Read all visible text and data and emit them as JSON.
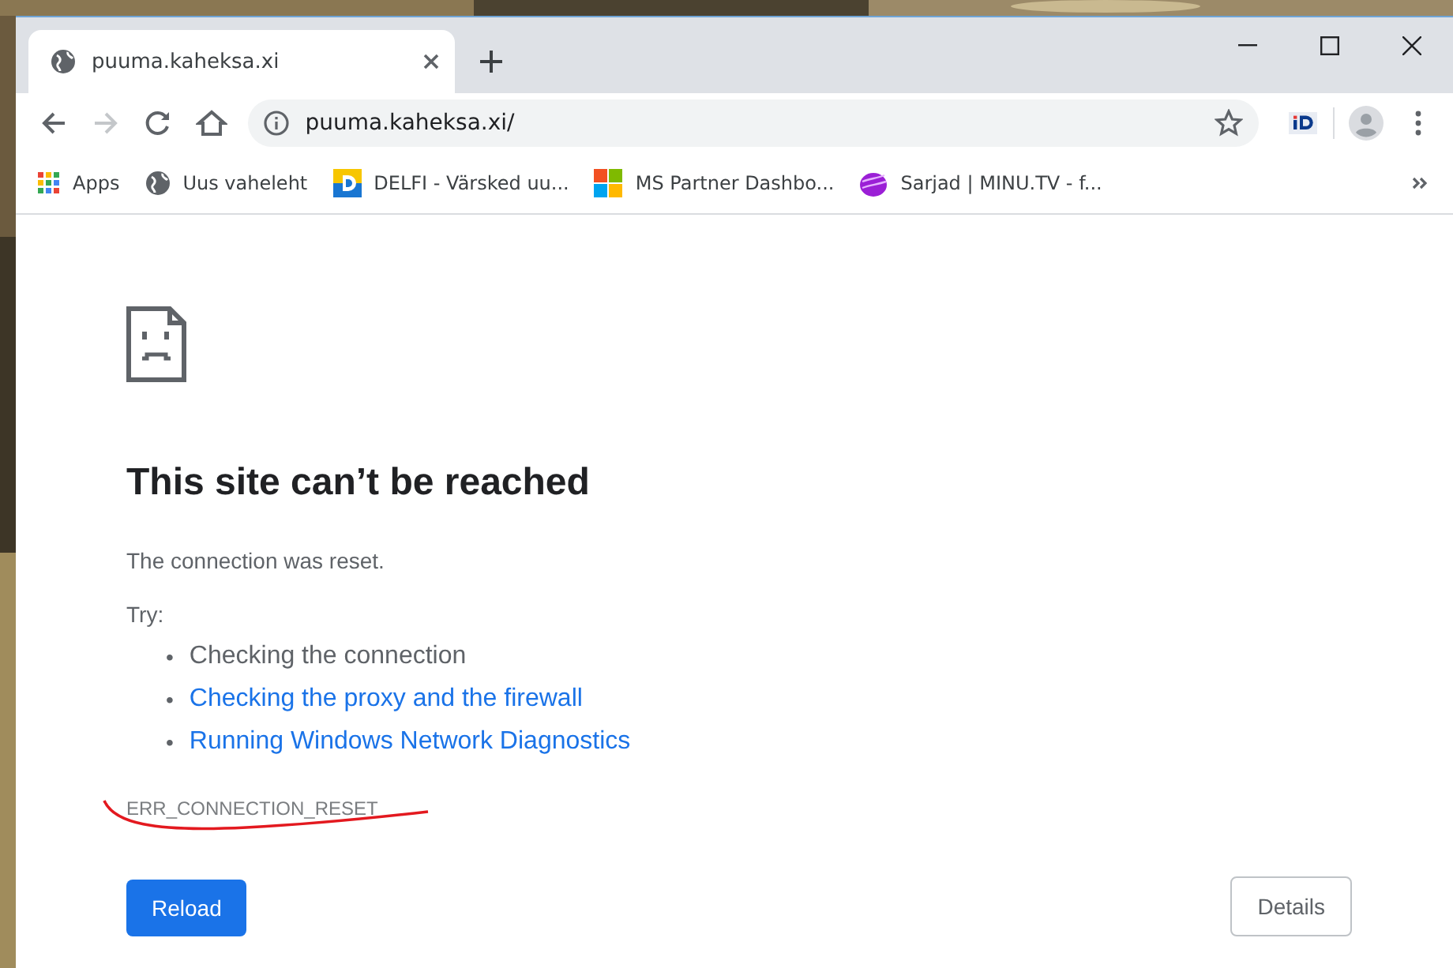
{
  "tabs": [
    {
      "title": "puuma.kaheksa.xi",
      "selected": true
    }
  ],
  "nav": [
    {
      "kind": "back",
      "disabled": false
    },
    {
      "kind": "forward",
      "disabled": true
    },
    {
      "kind": "reload",
      "disabled": false
    },
    {
      "kind": "home",
      "disabled": false
    }
  ],
  "address": {
    "url": "puuma.kaheksa.xi/",
    "bookmarked": false
  },
  "bookmarks": [
    {
      "kind": "apps",
      "label": "Apps"
    },
    {
      "kind": "globe",
      "label": "Uus vaheleht"
    },
    {
      "kind": "delfi",
      "label": "DELFI - Värsked uu..."
    },
    {
      "kind": "ms",
      "label": "MS Partner Dashbo..."
    },
    {
      "kind": "minu",
      "label": "Sarjad | MINU.TV - f..."
    }
  ],
  "error": {
    "title": "This site can’t be reached",
    "message": "The connection was reset.",
    "try_label": "Try:",
    "suggestions": [
      {
        "kind": "text",
        "bullet": "•",
        "text": "Checking the connection"
      },
      {
        "kind": "link",
        "bullet": "•",
        "text": "Checking the proxy and the firewall"
      },
      {
        "kind": "link",
        "bullet": "•",
        "text": "Running Windows Network Diagnostics"
      }
    ],
    "code": "ERR_CONNECTION_RESET",
    "underlined": true
  },
  "buttons": [
    {
      "kind": "primary",
      "label": "Reload"
    },
    {
      "kind": "secondary",
      "label": "Details"
    }
  ]
}
